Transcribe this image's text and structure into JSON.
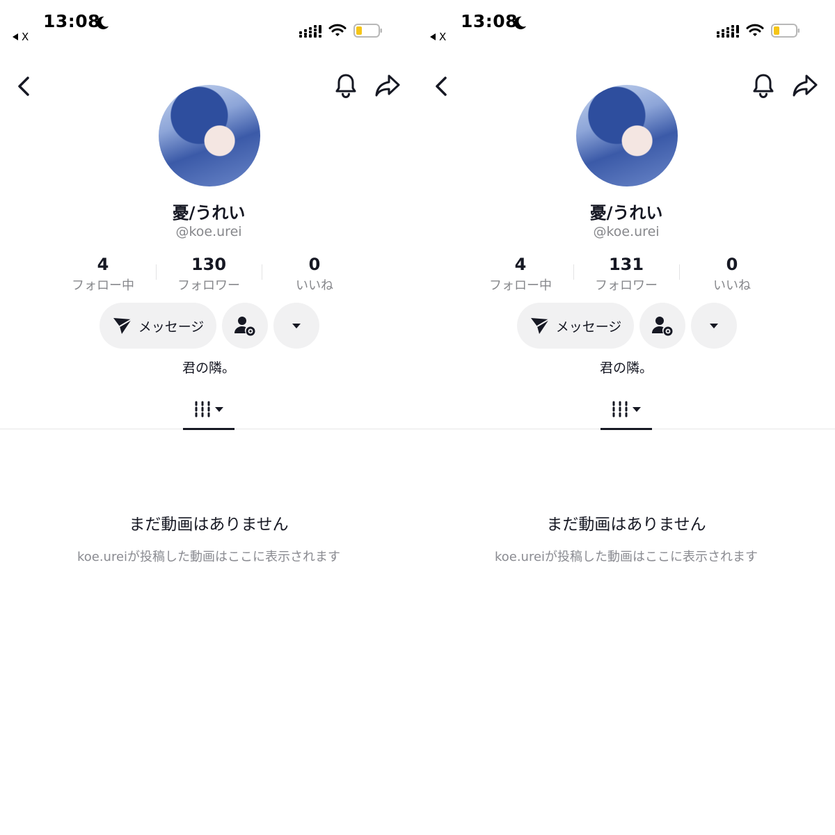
{
  "screens": [
    {
      "status": {
        "time": "13:08",
        "back_app": "X"
      },
      "profile": {
        "display_name": "憂/うれい",
        "handle": "@koe.urei",
        "stats": [
          {
            "value": "4",
            "label": "フォロー中"
          },
          {
            "value": "130",
            "label": "フォロワー"
          },
          {
            "value": "0",
            "label": "いいね"
          }
        ],
        "message_label": "メッセージ",
        "bio": "君の隣。"
      },
      "empty": {
        "title": "まだ動画はありません",
        "subtitle": "koe.ureiが投稿した動画はここに表示されます"
      }
    },
    {
      "status": {
        "time": "13:08",
        "back_app": "X"
      },
      "profile": {
        "display_name": "憂/うれい",
        "handle": "@koe.urei",
        "stats": [
          {
            "value": "4",
            "label": "フォロー中"
          },
          {
            "value": "131",
            "label": "フォロワー"
          },
          {
            "value": "0",
            "label": "いいね"
          }
        ],
        "message_label": "メッセージ",
        "bio": "君の隣。"
      },
      "empty": {
        "title": "まだ動画はありません",
        "subtitle": "koe.ureiが投稿した動画はここに表示されます"
      }
    }
  ],
  "icons": {
    "status": [
      "moon-icon",
      "back-triangle-icon",
      "cellular-signal-icon",
      "wifi-icon",
      "battery-icon"
    ],
    "nav": [
      "chevron-left-icon",
      "bell-icon",
      "share-arrow-icon"
    ],
    "actions": [
      "send-paper-plane-icon",
      "user-settings-icon",
      "caret-down-icon"
    ],
    "tabs": [
      "video-grid-icon",
      "caret-down-icon"
    ]
  },
  "colors": {
    "text_primary": "#161823",
    "text_secondary": "#86878b",
    "button_bg": "#f1f1f2",
    "battery_low": "#f5c518"
  }
}
